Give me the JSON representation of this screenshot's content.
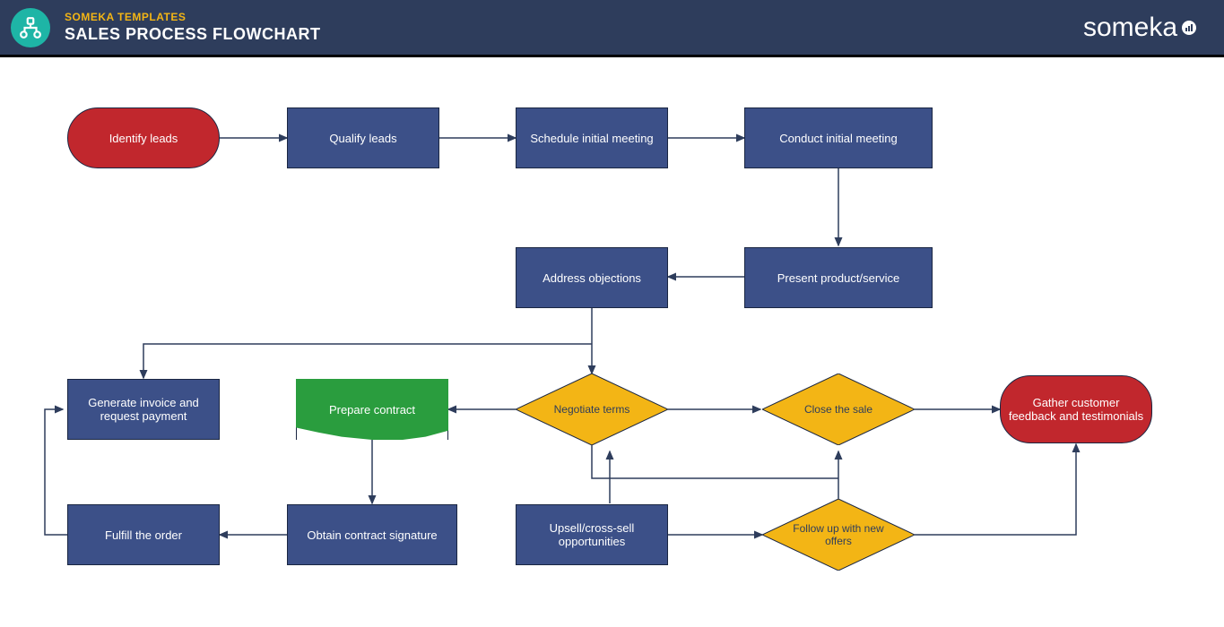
{
  "header": {
    "brand_label": "SOMEKA TEMPLATES",
    "title": "SALES PROCESS FLOWCHART",
    "brand_name": "someka"
  },
  "nodes": {
    "n1": "Identify leads",
    "n2": "Qualify leads",
    "n3": "Schedule initial meeting",
    "n4": "Conduct initial meeting",
    "n5": "Address objections",
    "n6": "Present product/service",
    "n7": "Generate invoice and request payment",
    "n8": "Prepare contract",
    "n9": "Negotiate terms",
    "n10": "Close the sale",
    "n11": "Gather customer feedback and testimonials",
    "n12": "Fulfill the order",
    "n13": "Obtain contract signature",
    "n14": "Upsell/cross-sell opportunities",
    "n15": "Follow up with new offers"
  }
}
